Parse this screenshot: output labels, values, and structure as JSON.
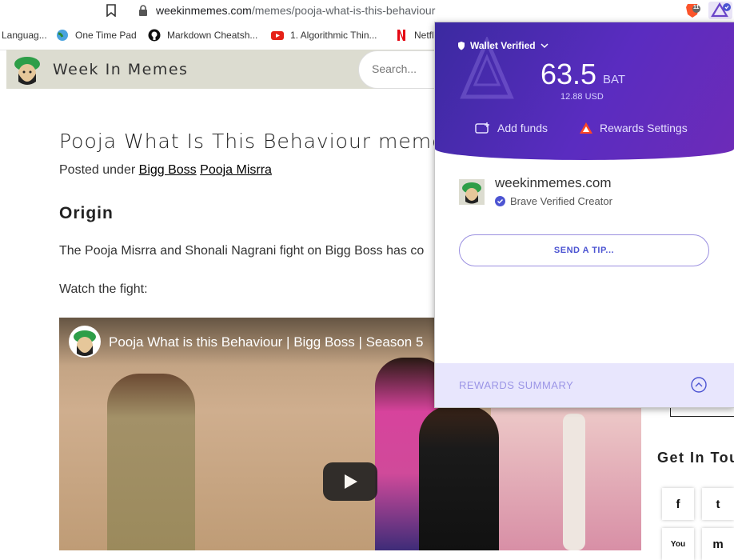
{
  "browser": {
    "url_domain": "weekinmemes.com",
    "url_path": "/memes/pooja-what-is-this-behaviour",
    "shield_count": "11"
  },
  "bookmarks": [
    {
      "label": "Languag...",
      "icon": "globe-icon"
    },
    {
      "label": "One Time Pad",
      "icon": "globe-icon"
    },
    {
      "label": "Markdown Cheatsh...",
      "icon": "github-icon"
    },
    {
      "label": "1. Algorithmic Thin...",
      "icon": "youtube-icon"
    },
    {
      "label": "Netfl",
      "icon": "netflix-icon"
    }
  ],
  "site": {
    "title": "Week In Memes",
    "search_placeholder": "Search..."
  },
  "article": {
    "title": "Pooja What Is This Behaviour memes",
    "posted_prefix": "Posted under",
    "tags": [
      "Bigg Boss",
      "Pooja Misrra"
    ],
    "origin_heading": "Origin",
    "paragraph": "The Pooja Misrra and Shonali Nagrani fight on Bigg Boss has co",
    "watch_text": "Watch the fight:"
  },
  "video": {
    "title": "Pooja What is this Behaviour | Bigg Boss | Season 5"
  },
  "sidebar": {
    "get_in_touch": "Get In Tou",
    "social": [
      "f",
      "t",
      "You",
      "m"
    ]
  },
  "rewards_panel": {
    "wallet_status": "Wallet Verified",
    "balance": "63.5",
    "currency": "BAT",
    "usd": "12.88 USD",
    "add_funds": "Add funds",
    "rewards_settings": "Rewards Settings",
    "publisher": "weekinmemes.com",
    "publisher_status": "Brave Verified Creator",
    "send_tip": "SEND A TIP...",
    "summary": "REWARDS SUMMARY"
  },
  "colors": {
    "panel_purple": "#4a2bb0",
    "tip_blue": "#4c54d2",
    "summary_bg": "#e8e6fd"
  }
}
